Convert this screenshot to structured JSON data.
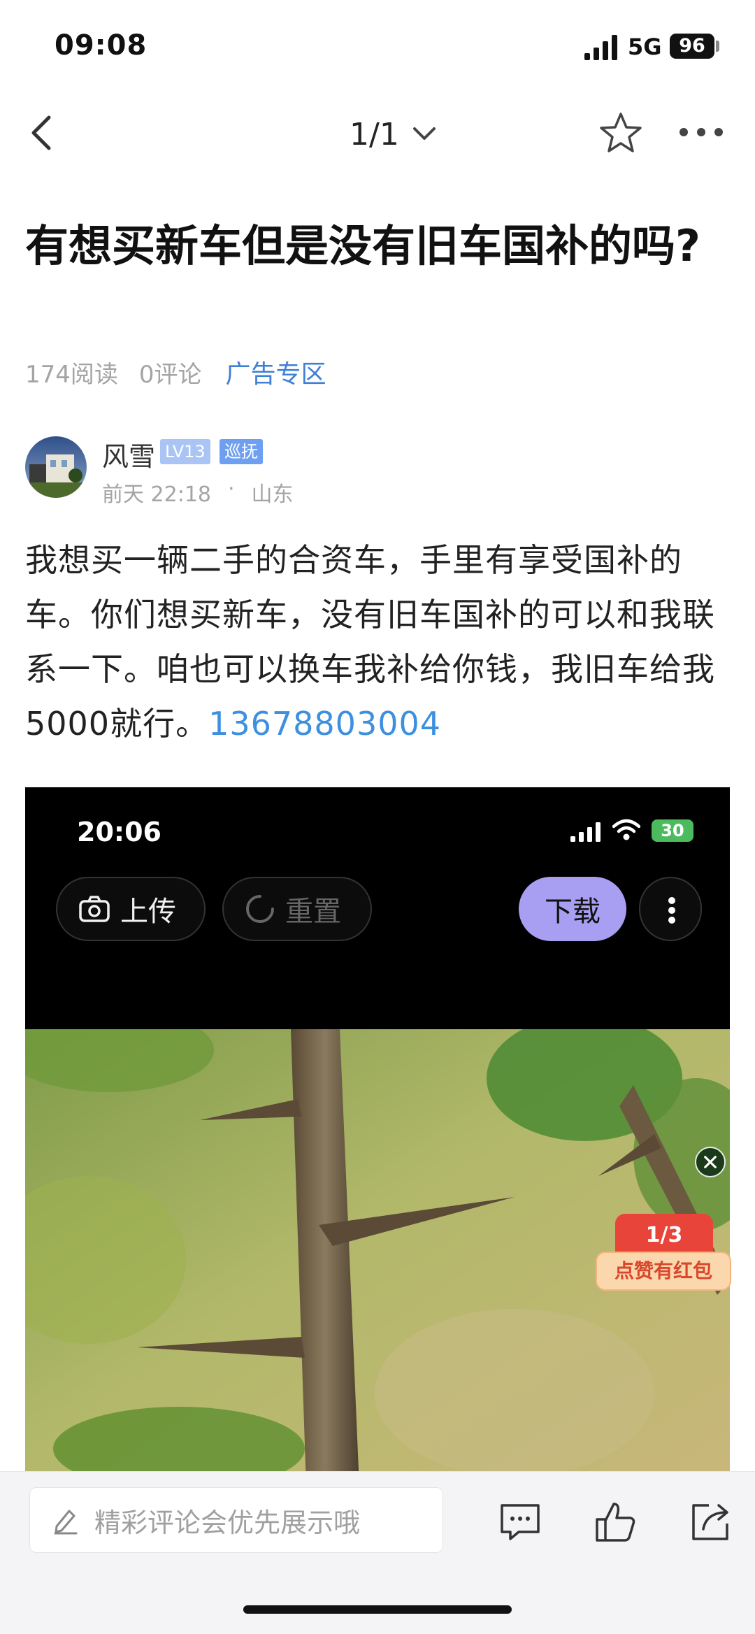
{
  "status_bar": {
    "time": "09:08",
    "network": "5G",
    "battery": "96"
  },
  "nav": {
    "page_indicator": "1/1"
  },
  "article": {
    "title": "有想买新车但是没有旧车国补的吗?",
    "reads": "174阅读",
    "comments": "0评论",
    "category": "广告专区",
    "author": {
      "name": "风雪",
      "level": "LV13",
      "role": "巡抚",
      "time": "前天 22:18",
      "separator": "·",
      "location": "山东"
    },
    "body": "我想买一辆二手的合资车，手里有享受国补的车。你们想买新车，没有旧车国补的可以和我联系一下。咱也可以换车我补给你钱，我旧车给我5000就行。",
    "phone": "13678803004"
  },
  "embedded_image": {
    "time": "20:06",
    "battery": "30",
    "upload_label": "上传",
    "reset_label": "重置",
    "download_label": "下载"
  },
  "floating": {
    "red_packet_count": "1/3",
    "red_packet_label": "点赞有红包"
  },
  "bottom_bar": {
    "comment_placeholder": "精彩评论会优先展示哦"
  },
  "icons": [
    "back-icon",
    "chevron-down-icon",
    "star-icon",
    "more-icon",
    "edit-icon",
    "comment-icon",
    "like-icon",
    "share-icon",
    "camera-icon",
    "refresh-icon",
    "close-icon"
  ],
  "colors": {
    "link": "#3f7fd6",
    "phone": "#3d8fe0",
    "download_button": "#a89ff2",
    "red_packet": "#e8443a"
  }
}
